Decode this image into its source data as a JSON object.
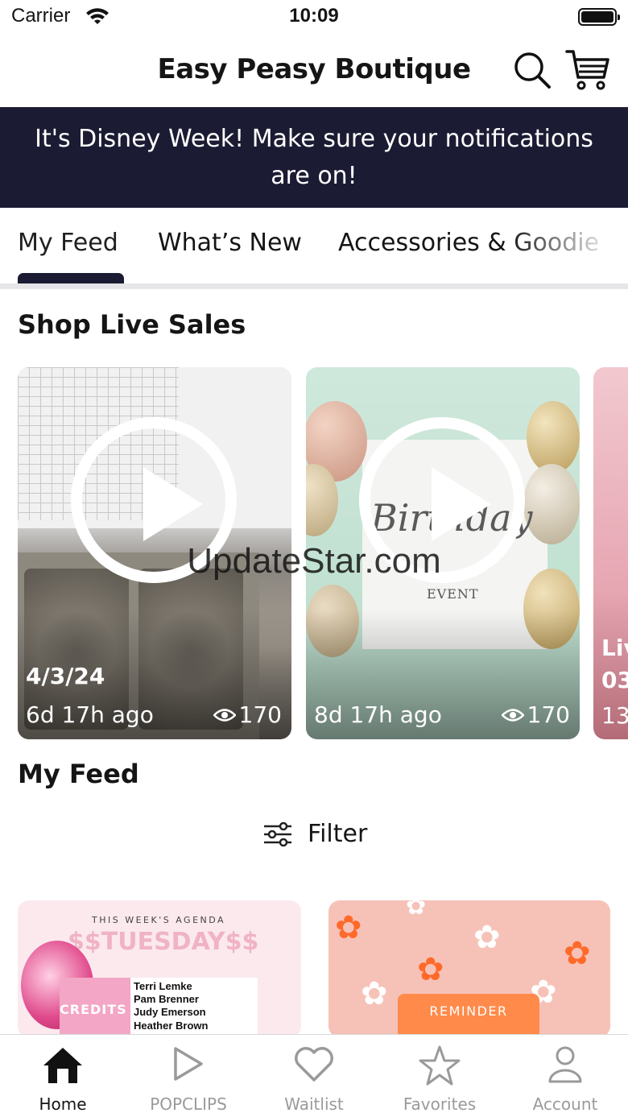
{
  "status_bar": {
    "carrier": "Carrier",
    "time": "10:09"
  },
  "header": {
    "title": "Easy Peasy Boutique"
  },
  "banner": {
    "text": "It's Disney Week! Make sure your notifications are on!"
  },
  "tabs": [
    {
      "label": "My Feed",
      "selected": true
    },
    {
      "label": "What’s New",
      "selected": false
    },
    {
      "label": "Accessories & Goodie",
      "selected": false
    }
  ],
  "live_sales": {
    "title": "Shop Live Sales",
    "cards": [
      {
        "date": "4/3/24",
        "ago": "6d 17h ago",
        "views": "170"
      },
      {
        "date": "",
        "ago": "8d 17h ago",
        "views": "170",
        "event_script": "Birthday",
        "event_sub": "EVENT"
      },
      {
        "date": "Liv",
        "ago": "03",
        "views": "13"
      }
    ]
  },
  "watermark": "UpdateStar.com",
  "feed": {
    "title": "My Feed",
    "filter_label": "Filter",
    "cards": [
      {
        "agenda_label": "THIS WEEK'S AGENDA",
        "agenda_title": "$$TUESDAY$$",
        "credits": "CREDITS",
        "names": [
          "Terri Lemke",
          "Pam Brenner",
          "Judy Emerson",
          "Heather Brown"
        ]
      },
      {
        "reminder": "REMINDER"
      }
    ]
  },
  "bottom_nav": [
    {
      "label": "Home",
      "icon": "home-icon",
      "active": true
    },
    {
      "label": "POPCLIPS",
      "icon": "play-icon",
      "active": false
    },
    {
      "label": "Waitlist",
      "icon": "heart-icon",
      "active": false
    },
    {
      "label": "Favorites",
      "icon": "star-icon",
      "active": false
    },
    {
      "label": "Account",
      "icon": "person-icon",
      "active": false
    }
  ],
  "colors": {
    "brand_dark": "#1b1b33",
    "inactive": "#9a9a9a",
    "divider": "#e6e6e8"
  }
}
